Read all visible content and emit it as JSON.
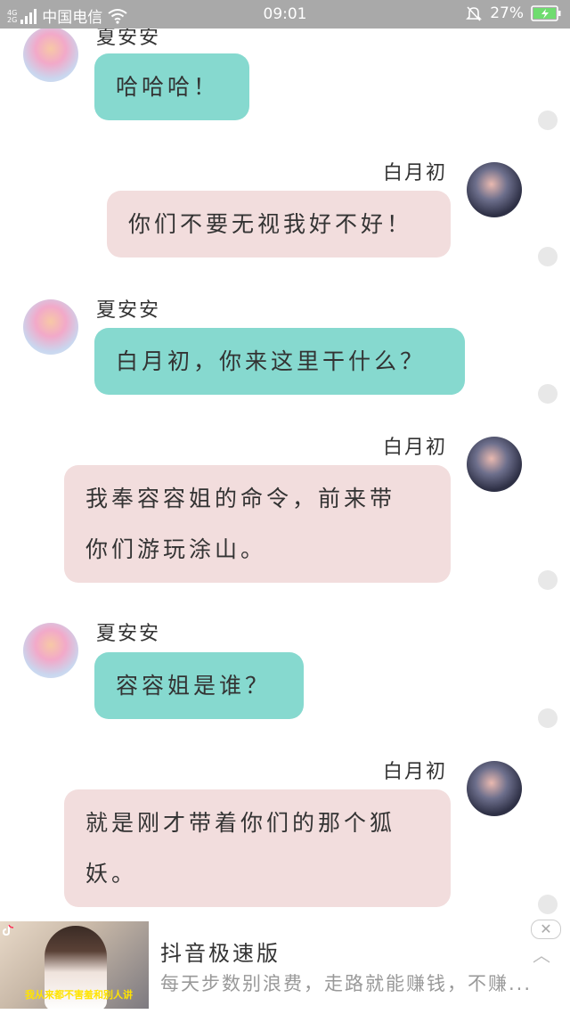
{
  "status_bar": {
    "network_top": "4G",
    "network_bottom": "2G",
    "carrier": "中国电信",
    "time": "09:01",
    "battery": "27%"
  },
  "messages": [
    {
      "sender": "夏安安",
      "text": "哈哈哈！"
    },
    {
      "sender": "白月初",
      "text": "你们不要无视我好不好！"
    },
    {
      "sender": "夏安安",
      "text": "白月初，你来这里干什么？"
    },
    {
      "sender": "白月初",
      "text": "我奉容容姐的命令，前来带你们游玩涂山。"
    },
    {
      "sender": "夏安安",
      "text": "容容姐是谁？"
    },
    {
      "sender": "白月初",
      "text": "就是刚才带着你们的那个狐妖。"
    }
  ],
  "ad": {
    "thumbnail_caption": "我从来都不害羞和别人讲",
    "title": "抖音极速版",
    "description": "每天步数别浪费，走路就能赚钱，不赚..."
  }
}
